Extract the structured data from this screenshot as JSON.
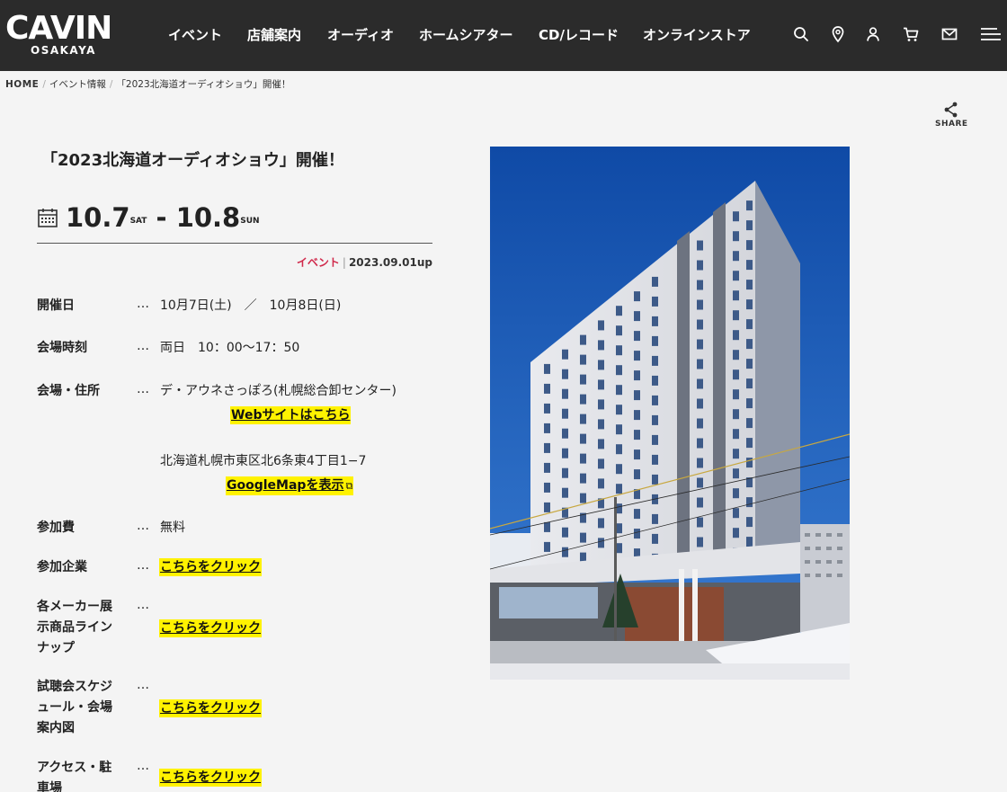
{
  "header": {
    "logo_main": "CAVIN",
    "logo_sub": "OSAKAYA",
    "nav": [
      "イベント",
      "店舗案内",
      "オーディオ",
      "ホームシアター",
      "CD/レコード",
      "オンラインストア"
    ],
    "icons": [
      "search-icon",
      "location-icon",
      "user-icon",
      "cart-icon",
      "mail-icon",
      "menu-icon"
    ]
  },
  "breadcrumb": {
    "home": "HOME",
    "events": "イベント情報",
    "current": "「2023北海道オーディオショウ」開催！"
  },
  "share": {
    "label": "SHARE"
  },
  "article": {
    "title": "「2023北海道オーディオショウ」開催！",
    "date_start": "10.7",
    "date_start_day": "SAT",
    "date_sep": " - ",
    "date_end": "10.8",
    "date_end_day": "SUN",
    "category": "イベント",
    "posted": "2023.09.01up"
  },
  "info": {
    "dots": "…",
    "date": {
      "label": "開催日",
      "value": "10月7日(土)　／　10月8日(日)"
    },
    "hours": {
      "label": "会場時刻",
      "value": "両日　10：00〜17：50"
    },
    "venue": {
      "label": "会場・住所",
      "value": "デ・アウネさっぽろ(札幌総合卸センター)",
      "website_link": "Webサイトはこちら",
      "address": "北海道札幌市東区北6条東4丁目1−7",
      "map_link": "GoogleMapを表示"
    },
    "fee": {
      "label": "参加費",
      "value": "無料"
    },
    "companies": {
      "label": "参加企業",
      "link": "こちらをクリック"
    },
    "lineup": {
      "label_lines": [
        "各メーカー展",
        "示商品ライン",
        "ナップ"
      ],
      "link": "こちらをクリック"
    },
    "schedule": {
      "label_lines": [
        "試聴会スケジ",
        "ュール・会場",
        "案内図"
      ],
      "link": "こちらをクリック"
    },
    "access": {
      "label_lines": [
        "アクセス・駐",
        "車場"
      ],
      "link": "こちらをクリック"
    }
  },
  "colors": {
    "header_bg": "#2b2b2b",
    "page_bg": "#f4f4f4",
    "accent_red": "#d0284a",
    "highlight": "#fff200",
    "sky": "#1f5db4"
  }
}
